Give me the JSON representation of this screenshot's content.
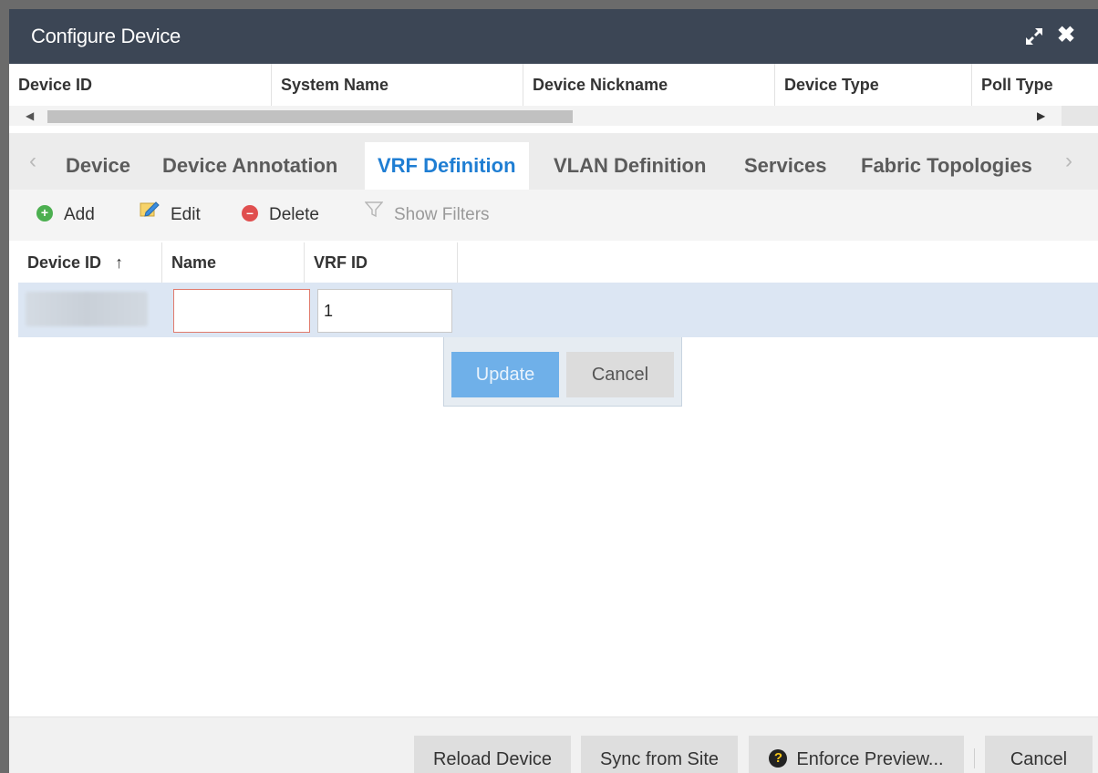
{
  "dialog": {
    "title": "Configure Device",
    "expand_icon": "expand-arrows-icon",
    "close_icon": "close-x-icon"
  },
  "device_table": {
    "columns": [
      "Device ID",
      "System Name",
      "Device Nickname",
      "Device Type",
      "Poll Type"
    ]
  },
  "tabs": {
    "prev_icon": "chevron-left-icon",
    "next_icon": "chevron-right-icon",
    "items": [
      "Device",
      "Device Annotation",
      "VRF Definition",
      "VLAN Definition",
      "Services",
      "Fabric Topologies"
    ],
    "active": "VRF Definition"
  },
  "toolbar": {
    "add_label": "Add",
    "edit_label": "Edit",
    "delete_label": "Delete",
    "filters_label": "Show Filters"
  },
  "vrf_grid": {
    "columns": [
      "Device ID",
      "Name",
      "VRF ID"
    ],
    "sort_indicator": "↑",
    "row": {
      "name_value": "",
      "vrf_id_value": "1"
    },
    "row_editor": {
      "update_label": "Update",
      "cancel_label": "Cancel"
    }
  },
  "footer": {
    "reload_label": "Reload Device",
    "sync_label": "Sync from Site",
    "enforce_label": "Enforce Preview...",
    "cancel_label": "Cancel"
  },
  "colors": {
    "titlebar": "#3c4655",
    "active_tab": "#1f7ed3",
    "selected_row": "#dce6f3",
    "update_button": "#6fb0e9"
  }
}
